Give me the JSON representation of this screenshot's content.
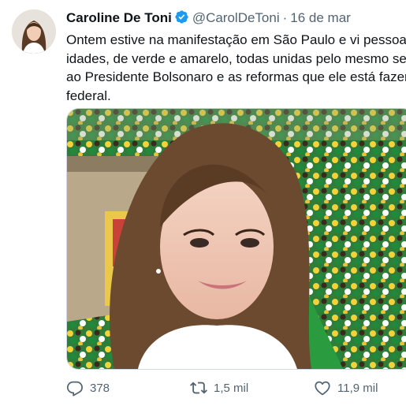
{
  "tweet": {
    "author_name": "Caroline De Toni",
    "handle": "@CarolDeToni",
    "separator": "·",
    "date": "16 de mar",
    "text_lines": [
      "Ontem estive na manifestação em São Paulo e vi pessoas",
      "idades, de verde e amarelo, todas unidas pelo mesmo se",
      "ao Presidente Bolsonaro e as reformas que ele está fazer",
      "federal."
    ]
  },
  "actions": {
    "replies": "378",
    "retweets": "1,5 mil",
    "likes": "11,9 mil"
  },
  "icons": {
    "verified": "verified-badge-icon",
    "reply": "reply-icon",
    "retweet": "retweet-icon",
    "like": "heart-icon"
  },
  "colors": {
    "verified": "#1d9bf0",
    "text": "#0f1419",
    "secondary": "#536471",
    "crowd_green": "#1f8a3c",
    "crowd_yellow": "#f2d43a"
  }
}
